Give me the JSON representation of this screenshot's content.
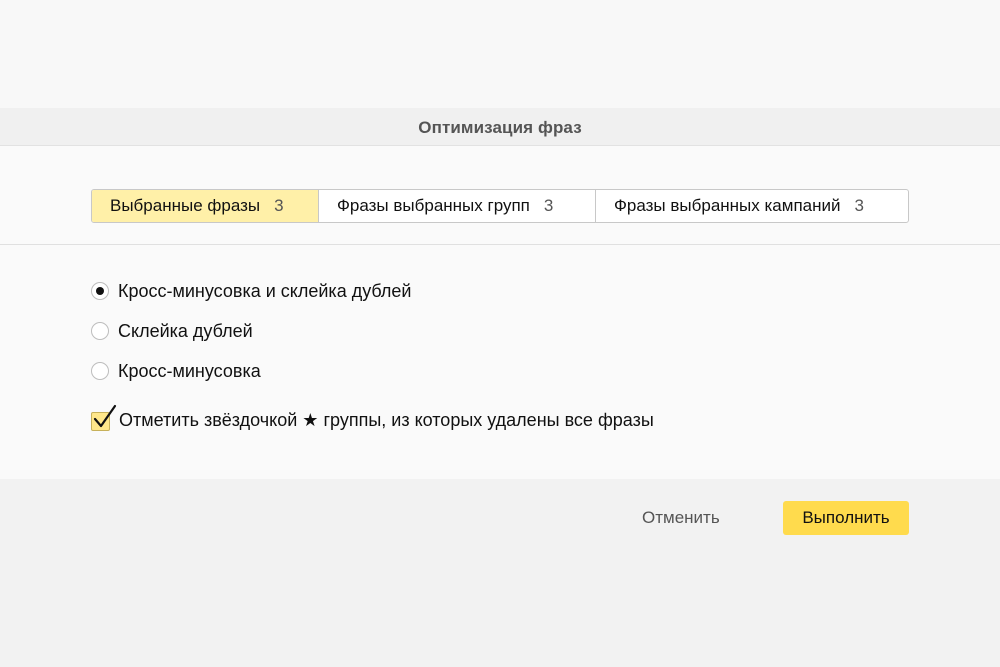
{
  "dialog": {
    "title": "Оптимизация фраз"
  },
  "tabs": [
    {
      "label": "Выбранные фразы",
      "count": "3",
      "active": true
    },
    {
      "label": "Фразы выбранных групп",
      "count": "3",
      "active": false
    },
    {
      "label": "Фразы выбранных кампаний",
      "count": "3",
      "active": false
    }
  ],
  "options": [
    {
      "label": "Кросс-минусовка и склейка дублей",
      "checked": true
    },
    {
      "label": "Склейка дублей",
      "checked": false
    },
    {
      "label": "Кросс-минусовка",
      "checked": false
    }
  ],
  "checkbox": {
    "label_before": "Отметить звёздочкой",
    "star": "★",
    "label_after": "группы, из которых удалены все фразы",
    "checked": true
  },
  "footer": {
    "cancel_label": "Отменить",
    "submit_label": "Выполнить"
  },
  "colors": {
    "active_tab": "#fff0a8",
    "submit_button": "#ffdb4d",
    "checkbox_fill": "#ffe78a"
  }
}
